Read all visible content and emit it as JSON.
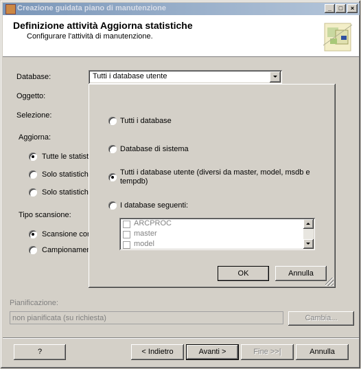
{
  "window": {
    "title": "Creazione guidata piano di manutenzione",
    "controls": [
      "_",
      "□",
      "×"
    ]
  },
  "header": {
    "title": "Definizione attività Aggiorna statistiche",
    "subtitle": "Configurare l'attività di manutenzione."
  },
  "form": {
    "database_label": "Database:",
    "database_value": "Tutti i database utente",
    "oggetto_label": "Oggetto:",
    "selezione_label": "Selezione:",
    "aggiorna_label": "Aggiorna:",
    "aggiorna_options": [
      "Tutte le statisti",
      "Solo statistiche",
      "Solo statistiche"
    ],
    "tipo_label": "Tipo scansione:",
    "tipo_options": [
      "Scansione cor",
      "Campionamen"
    ],
    "pianificazione_label": "Pianificazione:",
    "pianificazione_value": "non pianificata (su richiesta)",
    "cambia_label": "Cambia..."
  },
  "popup": {
    "options": [
      "Tutti i database",
      "Database di sistema",
      "Tutti i database utente (diversi da master, model, msdb e tempdb)",
      "I database seguenti:"
    ],
    "selected_index": 2,
    "db_list": [
      "ARCPROC",
      "master",
      "model"
    ],
    "ok_label": "OK",
    "annulla_label": "Annulla"
  },
  "footer": {
    "help_label": "?",
    "back_label": "< Indietro",
    "next_label": "Avanti >",
    "finish_label": "Fine >>|",
    "cancel_label": "Annulla"
  }
}
